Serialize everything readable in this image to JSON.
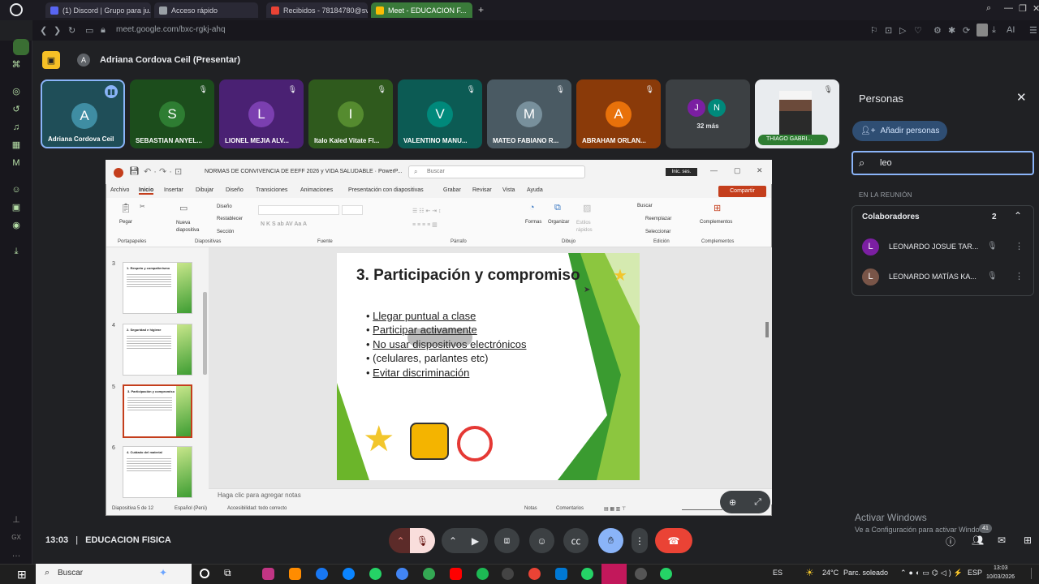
{
  "browser": {
    "tabs": [
      {
        "label": "(1) Discord | Grupo para ju...",
        "color": "#5865f2"
      },
      {
        "label": "Acceso rápido",
        "color": "#9aa0a6"
      },
      {
        "label": "Recibidos - 78184780@sv...",
        "color": "#ea4335"
      },
      {
        "label": "Meet - EDUCACION F...",
        "color": "#34a853"
      }
    ],
    "new_tab": "+",
    "url": "meet.google.com/bxc-rgkj-ahq",
    "ai_label": "AI"
  },
  "meet": {
    "presenter_label": "Adriana Cordova Ceil (Presentar)",
    "presenter_initial": "A",
    "participants": [
      {
        "initial": "A",
        "name": "Adriana Cordova Ceil",
        "bg": "#1f4e58",
        "av": "#3f8da3",
        "active": true
      },
      {
        "initial": "S",
        "name": "SEBASTIAN ANYEL...",
        "bg": "#1c4d1c",
        "av": "#2e7d32"
      },
      {
        "initial": "L",
        "name": "LIONEL MEJIA ALV...",
        "bg": "#4a2173",
        "av": "#7b3fb0"
      },
      {
        "initial": "I",
        "name": "Italo Kaled Vitate Fl...",
        "bg": "#2f5a1d",
        "av": "#558b2f"
      },
      {
        "initial": "V",
        "name": "VALENTINO MANU...",
        "bg": "#0c5b54",
        "av": "#00897b"
      },
      {
        "initial": "M",
        "name": "MATEO FABIANO R...",
        "bg": "#4a5a63",
        "av": "#78909c"
      },
      {
        "initial": "A",
        "name": "ABRAHAM ORLAN...",
        "bg": "#8a3a09",
        "av": "#e8710a"
      }
    ],
    "more": {
      "initials": [
        "J",
        "N"
      ],
      "label": "32 más"
    },
    "camera_tile": {
      "name": "THIAGO GABRI..."
    },
    "people_panel": {
      "title": "Personas",
      "add_button": "Añadir personas",
      "search_value": "leo",
      "section_label": "EN LA REUNIÓN",
      "group_title": "Colaboradores",
      "group_count": "2",
      "people": [
        {
          "initial": "L",
          "name": "LEONARDO JOSUE TAR...",
          "color": "#7b1fa2"
        },
        {
          "initial": "L",
          "name": "LEONARDO MATÍAS KA...",
          "color": "#795548"
        }
      ]
    },
    "bottom": {
      "time": "13:03",
      "separator": "|",
      "meeting_name": "EDUCACION FISICA",
      "participants_badge": "41"
    },
    "watermark": {
      "line1": "Activar Windows",
      "line2": "Ve a Configuración para activar Windows."
    }
  },
  "powerpoint": {
    "doc_title": "NORMAS DE CONVIVENCIA DE EEFF 2026 y VIDA SALUDABLE · PowerP...",
    "search_placeholder": "Buscar",
    "signin": "Inic. ses.",
    "share": "Compartir",
    "ribbon_tabs": [
      "Archivo",
      "Inicio",
      "Insertar",
      "Dibujar",
      "Diseño",
      "Transiciones",
      "Animaciones",
      "Presentación con diapositivas",
      "Grabar",
      "Revisar",
      "Vista",
      "Ayuda"
    ],
    "groups": [
      "Portapapeles",
      "Diapositivas",
      "Fuente",
      "Párrafo",
      "Dibujo",
      "Edición",
      "Complementos"
    ],
    "ribbon_items": {
      "pegar": "Pegar",
      "nueva": "Nueva diapositiva",
      "diseno": "Diseño",
      "restablecer": "Restablecer",
      "seccion": "Sección",
      "formas": "Formas",
      "organizar": "Organizar",
      "estilos": "Estilos rápidos",
      "buscar": "Buscar",
      "reemplazar": "Reemplazar",
      "seleccionar": "Seleccionar",
      "complementos": "Complementos"
    },
    "thumbnails": [
      {
        "num": "3",
        "title": "1. Respeto y compañerismo"
      },
      {
        "num": "4",
        "title": "2. Seguridad e higiene"
      },
      {
        "num": "5",
        "title": "3. Participación y compromiso",
        "selected": true
      },
      {
        "num": "6",
        "title": "4. Cuidado del material"
      }
    ],
    "slide": {
      "title": "3. Participación y compromiso",
      "bullets": [
        "Llegar puntual a clase",
        "Participar activamente",
        "No usar dispositivos electrónicos",
        "(celulares, parlantes etc)",
        "Evitar discriminación"
      ]
    },
    "notes_placeholder": "Haga clic para agregar notas",
    "status": {
      "slide_count": "Diapositiva 5 de 12",
      "language": "Español (Perú)",
      "accessibility": "Accesibilidad: todo correcto",
      "notes": "Notas",
      "comments": "Comentarios"
    }
  },
  "taskbar": {
    "search_placeholder": "Buscar",
    "lang": "ES",
    "temperature": "24°C",
    "weather": "Parc. soleado",
    "kbd": "ESP",
    "time": "13:03",
    "date": "10/03/2026"
  }
}
